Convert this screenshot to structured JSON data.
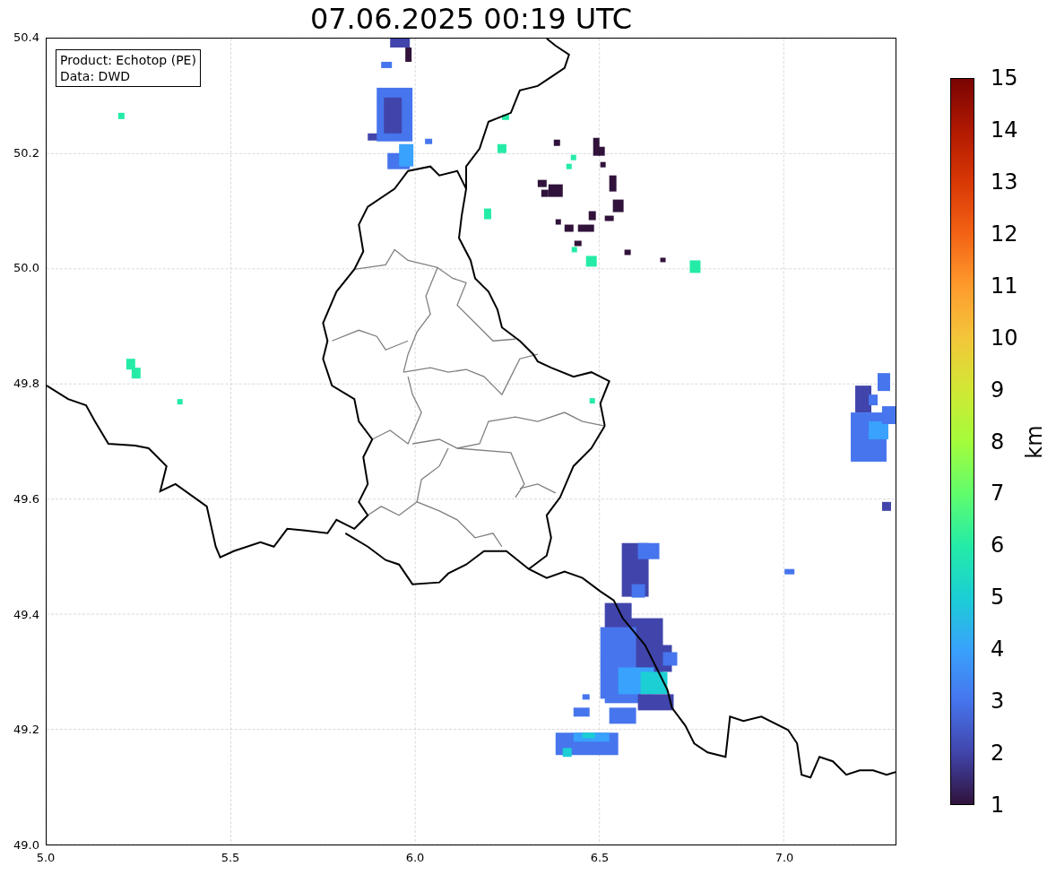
{
  "title": "07.06.2025 00:19 UTC",
  "info_box": {
    "lines": [
      "Product: Echotop (PE)",
      "Data: DWD"
    ]
  },
  "x_axis": {
    "ticks": [
      "5.0",
      "5.5",
      "6.0",
      "6.5",
      "7.0"
    ]
  },
  "y_axis": {
    "ticks": [
      "50.4",
      "50.2",
      "50.0",
      "49.8",
      "49.6",
      "49.4",
      "49.2",
      "49.0"
    ]
  },
  "colorbar": {
    "label": "km",
    "ticks": [
      "15",
      "14",
      "13",
      "12",
      "11",
      "10",
      "9",
      "8",
      "7",
      "6",
      "5",
      "4",
      "3",
      "2",
      "1"
    ]
  }
}
